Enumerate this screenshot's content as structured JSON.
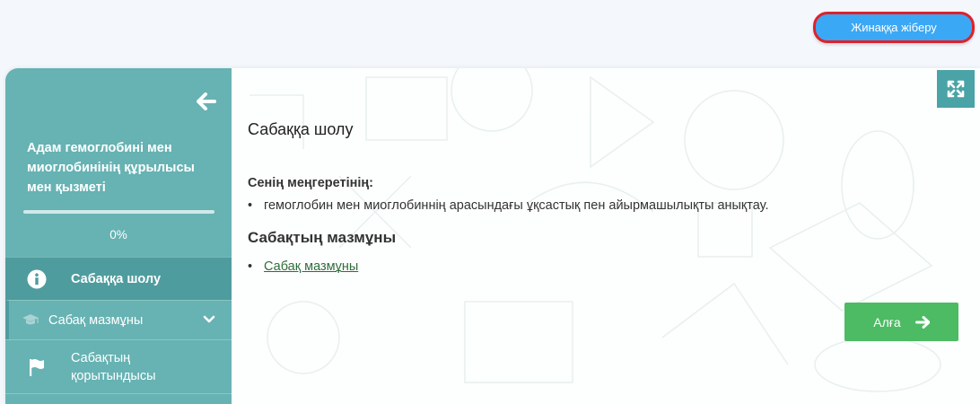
{
  "header": {
    "submit_button_label": "Жинаққа жіберу"
  },
  "sidebar": {
    "course_title": "Адам гемоглобині мен миоглобинінің құрылысы мен қызметі",
    "progress_text": "0%",
    "progress_value": 0,
    "items": [
      {
        "label": "Сабаққа шолу",
        "icon": "info-circle-icon",
        "active": true
      },
      {
        "label": "Сабақ мазмұны",
        "icon": "graduation-cap-icon",
        "expandable": true
      },
      {
        "label": "Сабақтың қорытындысы",
        "icon": "flag-icon"
      }
    ]
  },
  "main": {
    "heading": "Сабаққа шолу",
    "goals_heading": "Сенің меңгеретінің:",
    "goals": [
      "гемоглобин мен миоглобиннің арасындағы ұқсастық пен айырмашылықты анықтау."
    ],
    "content_heading": "Сабақтың мазмұны",
    "content_links": [
      "Сабақ мазмұны"
    ],
    "next_button_label": "Алға"
  },
  "colors": {
    "sidebar": "#67b2b3",
    "sidebar_active": "#4f9c9e",
    "submit_button": "#3aa8f5",
    "submit_outline": "#e0202a",
    "next_button": "#4cbb64",
    "link": "#2f6e3a"
  }
}
